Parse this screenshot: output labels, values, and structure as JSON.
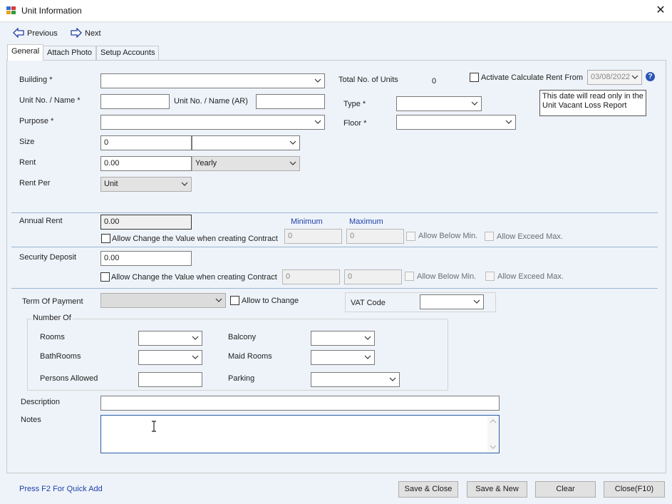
{
  "window": {
    "title": "Unit  Information",
    "close_glyph": "✕"
  },
  "nav": {
    "previous": "Previous",
    "next": "Next"
  },
  "tabs": [
    "General",
    "Attach Photo",
    "Setup Accounts"
  ],
  "general": {
    "building_label": "Building *",
    "unit_no_label": "Unit No. / Name *",
    "unit_no_ar_label": "Unit  No. / Name (AR)",
    "purpose_label": "Purpose *",
    "size_label": "Size",
    "size_value": "0",
    "rent_label": "Rent",
    "rent_value": "0.00",
    "rent_period": "Yearly",
    "rent_per_label": "Rent Per",
    "rent_per_value": "Unit",
    "total_units_label": "Total No. of Units",
    "total_units_value": "0",
    "type_label": "Type *",
    "floor_label": "Floor *",
    "activate_label": "Activate Calculate Rent From",
    "activate_date": "03/08/2022",
    "tooltip_line1": "This date will read only in the",
    "tooltip_line2": "Unit Vacant Loss Report"
  },
  "annual": {
    "label": "Annual Rent",
    "value": "0.00",
    "allow_change": "Allow Change the Value when creating Contract",
    "minimum_label": "Minimum",
    "maximum_label": "Maximum",
    "min_value": "0",
    "max_value": "0",
    "allow_below": "Allow Below Min.",
    "allow_exceed": "Allow Exceed Max."
  },
  "deposit": {
    "label": "Security Deposit",
    "value": "0.00",
    "allow_change": "Allow Change the Value when creating Contract",
    "min_value": "0",
    "max_value": "0",
    "allow_below": "Allow Below Min.",
    "allow_exceed": "Allow Exceed Max."
  },
  "payment": {
    "term_label": "Term Of Payment",
    "allow_to_change": "Allow to Change",
    "vat_label": "VAT Code"
  },
  "number_of": {
    "group_label": "Number Of",
    "rooms": "Rooms",
    "bathrooms": "BathRooms",
    "persons_allowed": "Persons Allowed",
    "balcony": "Balcony",
    "maid_rooms": "Maid Rooms",
    "parking": "Parking"
  },
  "description_label": "Description",
  "notes_label": "Notes",
  "footer": {
    "quick_add": "Press F2 For Quick Add",
    "save_close": "Save & Close",
    "save_new": "Save & New",
    "clear": "Clear",
    "close": "Close(F10)"
  },
  "colors": {
    "accent_blue": "#1f3ea8",
    "separator": "#9ab6cf",
    "background": "#eef3f9"
  }
}
